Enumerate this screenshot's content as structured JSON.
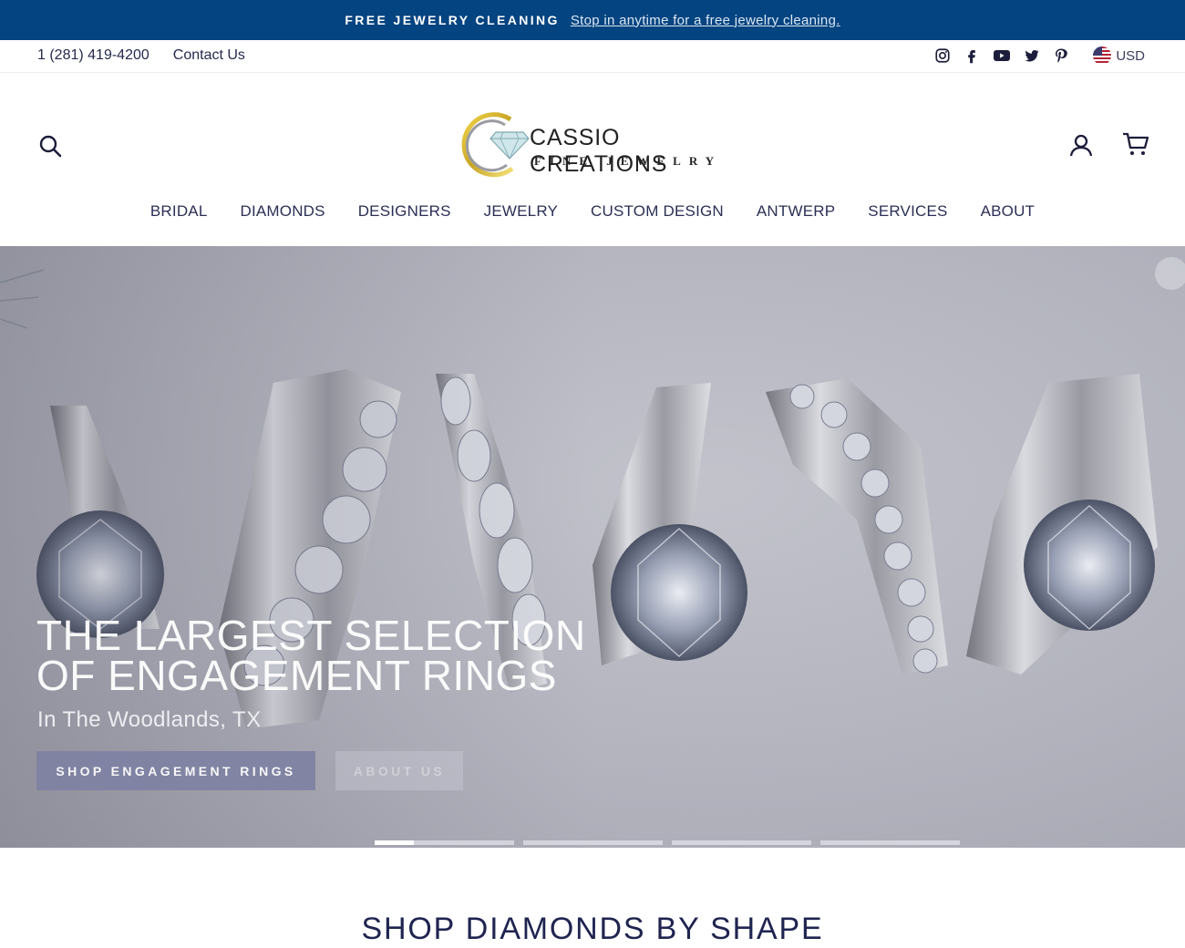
{
  "announcement": {
    "bold_text": "FREE JEWELRY CLEANING",
    "link_text": "Stop in anytime for a free jewelry cleaning."
  },
  "utility": {
    "phone": "1 (281) 419-4200",
    "contact": "Contact Us",
    "social": [
      "instagram-icon",
      "facebook-icon",
      "youtube-icon",
      "twitter-icon",
      "pinterest-icon"
    ],
    "currency": "USD"
  },
  "header": {
    "logo_line1": "CASSIO CREATIONS",
    "logo_line2": "FINE JEWELRY"
  },
  "nav": {
    "items": [
      "BRIDAL",
      "DIAMONDS",
      "DESIGNERS",
      "JEWELRY",
      "CUSTOM DESIGN",
      "ANTWERP",
      "SERVICES",
      "ABOUT"
    ]
  },
  "hero": {
    "title_line1": "THE LARGEST SELECTION",
    "title_line2": "OF ENGAGEMENT RINGS",
    "subtitle": "In The Woodlands, TX",
    "primary_button": "SHOP ENGAGEMENT RINGS",
    "secondary_button": "ABOUT US",
    "slide_count": 4,
    "active_slide": 1,
    "active_slide_progress": 0.28
  },
  "sections": {
    "shape_title": "SHOP DIAMONDS BY SHAPE"
  },
  "colors": {
    "announcement_bg": "#044480",
    "nav_text": "#2b2f55",
    "primary_button_bg": "#7f82a3"
  }
}
